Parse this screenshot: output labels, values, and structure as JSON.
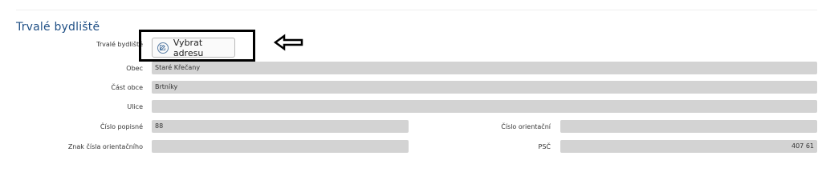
{
  "section": {
    "title": "Trvalé bydliště"
  },
  "address_picker": {
    "label": "Trvalé bydliště",
    "button_label": "Vybrat adresu",
    "button_icon": "edit-icon"
  },
  "fields": {
    "obec": {
      "label": "Obec",
      "value": "Staré Křečany"
    },
    "cast_obce": {
      "label": "Část obce",
      "value": "Brtníky"
    },
    "ulice": {
      "label": "Ulice",
      "value": ""
    },
    "cislo_popisne": {
      "label": "Číslo popisné",
      "value": "88"
    },
    "cislo_orientacni": {
      "label": "Číslo orientační",
      "value": ""
    },
    "znak_cisla": {
      "label": "Znak čísla orientačního",
      "value": ""
    },
    "psc": {
      "label": "PSČ",
      "value": "407 61"
    }
  },
  "annotation": {
    "arrow_icon": "left-arrow-icon",
    "highlight_color": "#000000"
  },
  "colors": {
    "title": "#1f4f85",
    "field_bg": "#d3d3d3"
  }
}
